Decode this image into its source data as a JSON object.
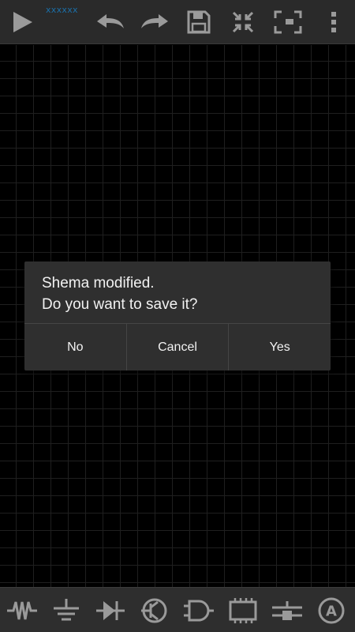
{
  "toolbar": {
    "label": "xxxxxx",
    "icons": [
      "play-icon",
      "undo-icon",
      "redo-icon",
      "save-icon",
      "compress-icon",
      "fullscreen-icon",
      "more-vert-icon"
    ]
  },
  "dialog": {
    "message": "Shema modified.\nDo you want to save it?",
    "buttons": {
      "no": "No",
      "cancel": "Cancel",
      "yes": "Yes"
    }
  },
  "palette": {
    "items": [
      "resistor-icon",
      "ground-icon",
      "diode-icon",
      "transistor-icon",
      "logic-gate-icon",
      "chip-icon",
      "switch-icon",
      "probe-a-icon"
    ],
    "probe_letter": "A"
  },
  "colors": {
    "icon": "#9a9a9a",
    "toolbar": "#2a2a2a",
    "dialog": "#2f2f2f",
    "grid": "#1f1f1f"
  }
}
